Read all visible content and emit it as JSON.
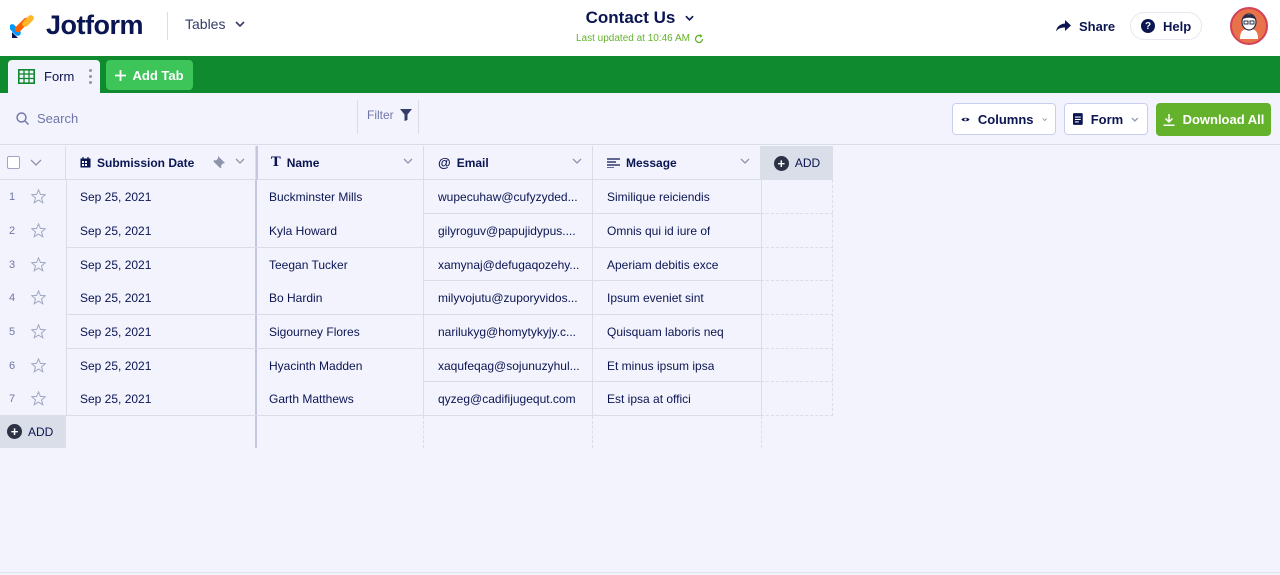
{
  "header": {
    "brand": "Jotform",
    "tables_label": "Tables",
    "title": "Contact Us",
    "last_updated": "Last updated at 10:46 AM",
    "share_label": "Share",
    "help_label": "Help"
  },
  "tabs": {
    "active_tab": "Form",
    "add_tab_label": "Add Tab"
  },
  "toolbar": {
    "search_placeholder": "Search",
    "filter_label": "Filter",
    "columns_label": "Columns",
    "view_label": "Form",
    "download_label": "Download All"
  },
  "table": {
    "columns": [
      "Submission Date",
      "Name",
      "Email",
      "Message"
    ],
    "add_column_label": "ADD",
    "add_row_label": "ADD",
    "rows": [
      {
        "num": "1",
        "date": "Sep 25, 2021",
        "name": "Buckminster Mills",
        "email": "wupecuhaw@cufyzyded...",
        "message": "Similique reiciendis"
      },
      {
        "num": "2",
        "date": "Sep 25, 2021",
        "name": "Kyla Howard",
        "email": "gilyroguv@papujidypus....",
        "message": "Omnis qui id iure of"
      },
      {
        "num": "3",
        "date": "Sep 25, 2021",
        "name": "Teegan Tucker",
        "email": "xamynaj@defugaqozehy...",
        "message": "Aperiam debitis exce"
      },
      {
        "num": "4",
        "date": "Sep 25, 2021",
        "name": "Bo Hardin",
        "email": "milyvojutu@zuporyvidos...",
        "message": "Ipsum eveniet sint"
      },
      {
        "num": "5",
        "date": "Sep 25, 2021",
        "name": "Sigourney Flores",
        "email": "narilukyg@homytykyjy.c...",
        "message": "Quisquam laboris neq"
      },
      {
        "num": "6",
        "date": "Sep 25, 2021",
        "name": "Hyacinth Madden",
        "email": "xaqufeqag@sojunuzyhul...",
        "message": "Et minus ipsum ipsa"
      },
      {
        "num": "7",
        "date": "Sep 25, 2021",
        "name": "Garth Matthews",
        "email": "qyzeg@cadifijugequt.com",
        "message": "Est ipsa at offici"
      }
    ]
  },
  "colors": {
    "tab_bar": "#0f8a2e",
    "add_tab": "#3dc55a",
    "download": "#64b22b",
    "text": "#0a1551"
  }
}
